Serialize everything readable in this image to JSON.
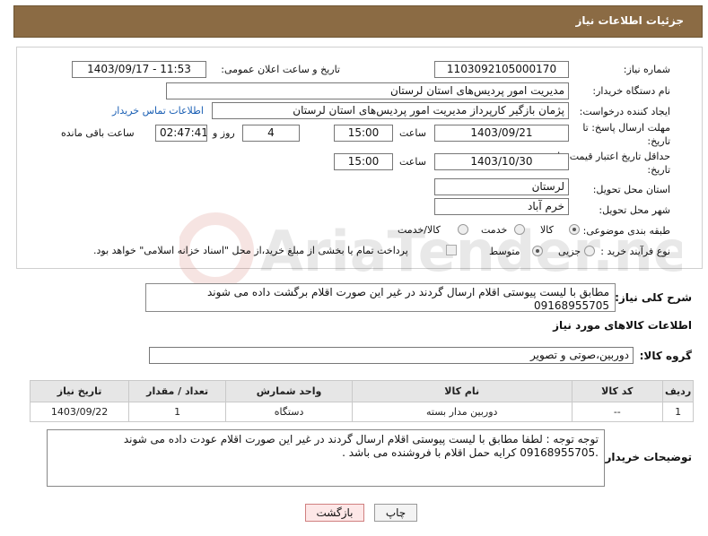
{
  "header": {
    "title": "جزئیات اطلاعات نیاز"
  },
  "form": {
    "need_number": {
      "label": "شماره نیاز:",
      "value": "1103092105000170"
    },
    "announce": {
      "label": "تاریخ و ساعت اعلان عمومی:",
      "value": "1403/09/17 - 11:53"
    },
    "buyer_org": {
      "label": "نام دستگاه خریدار:",
      "value": "مدیریت امور پردیس‌های استان لرستان"
    },
    "requester": {
      "label": "ایجاد کننده درخواست:",
      "value": "پژمان بازگیر کارپرداز  مدیریت امور پردیس‌های استان لرستان",
      "contact_link": "اطلاعات تماس خریدار"
    },
    "deadline": {
      "label": "مهلت ارسال پاسخ: تا تاریخ:",
      "date": "1403/09/21",
      "time_label": "ساعت",
      "time": "15:00",
      "days": "4",
      "days_label": "روز و",
      "remaining": "02:47:41",
      "remaining_label": "ساعت باقی مانده"
    },
    "price_validity": {
      "label": "حداقل تاریخ اعتبار قیمت: تا تاریخ:",
      "date": "1403/10/30",
      "time_label": "ساعت",
      "time": "15:00"
    },
    "province": {
      "label": "استان محل تحویل:",
      "value": "لرستان"
    },
    "city": {
      "label": "شهر محل تحویل:",
      "value": "خرم آباد"
    },
    "category": {
      "label": "طبقه بندی موضوعی:",
      "options": [
        "کالا",
        "خدمت",
        "کالا/خدمت"
      ],
      "selected": "کالا"
    },
    "process": {
      "label": "نوع فرآیند خرید :",
      "options": [
        "جزیی",
        "متوسط"
      ],
      "selected": "متوسط",
      "payment_note": "پرداخت تمام یا بخشی از مبلغ خرید،از محل \"اسناد خزانه اسلامی\" خواهد بود."
    }
  },
  "general_description": {
    "label": "شرح کلی نیاز:",
    "text": "مطابق با لیست پیوستی اقلام ارسال گردند در غیر این صورت اقلام برگشت داده می شوند 09168955705"
  },
  "goods_info": {
    "title": "اطلاعات کالاهای مورد نیاز",
    "group_label": "گروه کالا:",
    "group_value": "دوربین،صوتی و تصویر",
    "columns": [
      "ردیف",
      "کد کالا",
      "نام کالا",
      "واحد شمارش",
      "تعداد / مقدار",
      "تاریخ نیاز"
    ],
    "rows": [
      [
        "1",
        "--",
        "دوربین مدار بسته",
        "دستگاه",
        "1",
        "1403/09/22"
      ]
    ]
  },
  "buyer_notes": {
    "label": "توضیحات خریدار:",
    "text": "توجه توجه : لطفا مطابق با لیست پیوستی اقلام ارسال گردند در غیر این صورت اقلام عودت داده می شوند  .09168955705 کرایه حمل اقلام با فروشنده می باشد ."
  },
  "buttons": {
    "print": "چاپ",
    "back": "بازگشت"
  },
  "watermark": {
    "text": "AriaTender.net"
  }
}
